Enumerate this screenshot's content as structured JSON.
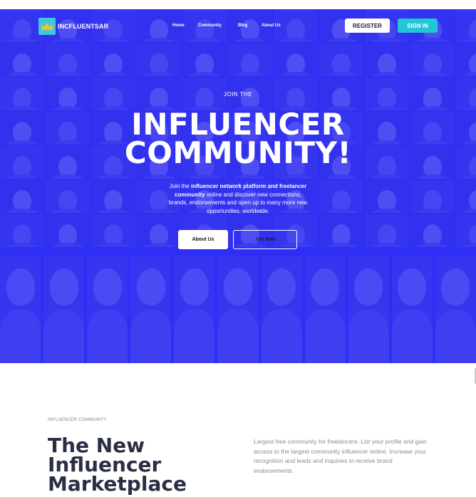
{
  "nav": {
    "brand": "INCFLUENTSAR",
    "items": [
      {
        "label": "Home"
      },
      {
        "label": "Community"
      },
      {
        "label": "Blog"
      },
      {
        "label": "About Us"
      }
    ],
    "register_label": "REGISTER",
    "signin_label": "SIGN IN",
    "logo_icon": "crown-icon"
  },
  "hero": {
    "eyebrow": "JOIN THE",
    "headline_line1": "INFLUENCER",
    "headline_line2": "COMMUNITY!",
    "description": {
      "part1": "Join the ",
      "bold1": "influencer network platform and freelancer community",
      "part2": " online and discover new connections, brands, endorsements and open up to many more new opportunities, worldwide."
    },
    "about_button": "About Us",
    "join_button": "Join Now"
  },
  "section": {
    "eyebrow": "INFLUENCER COMMUNITY",
    "title_line1": "The New Influencer",
    "title_line2": "Marketplace",
    "intro": "Largest free community for freelancers. List your profile and gain access to the largest community influencer online.  Increase your recognition and leads and inquiries to receive brand endorsements."
  },
  "colors": {
    "hero_blue": "#2f2ff5",
    "accent_cyan": "#23c6d6",
    "heading_dark": "#2b2f45"
  }
}
